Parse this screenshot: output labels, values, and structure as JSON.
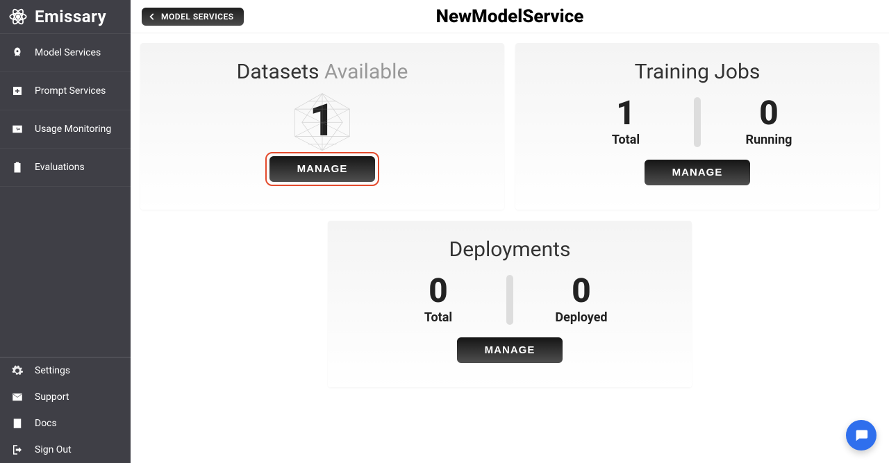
{
  "brand": "Emissary",
  "sidebar": {
    "primary": [
      {
        "label": "Model Services"
      },
      {
        "label": "Prompt Services"
      },
      {
        "label": "Usage Monitoring"
      },
      {
        "label": "Evaluations"
      }
    ],
    "secondary": [
      {
        "label": "Settings"
      },
      {
        "label": "Support"
      },
      {
        "label": "Docs"
      },
      {
        "label": "Sign Out"
      }
    ]
  },
  "header": {
    "back_label": "MODEL SERVICES",
    "title": "NewModelService"
  },
  "cards": {
    "datasets": {
      "title_main": "Datasets",
      "title_muted": "Available",
      "count": "1",
      "manage": "MANAGE"
    },
    "training": {
      "title": "Training Jobs",
      "total_value": "1",
      "total_label": "Total",
      "running_value": "0",
      "running_label": "Running",
      "manage": "MANAGE"
    },
    "deploy": {
      "title": "Deployments",
      "total_value": "0",
      "total_label": "Total",
      "deployed_value": "0",
      "deployed_label": "Deployed",
      "manage": "MANAGE"
    }
  }
}
